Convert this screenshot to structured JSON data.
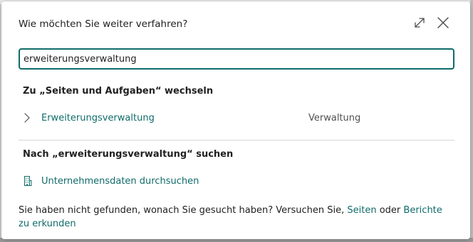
{
  "dialog": {
    "title": "Wie möchten Sie weiter verfahren?"
  },
  "search": {
    "value": "erweiterungsverwaltung"
  },
  "pages_section": {
    "heading": "Zu „Seiten und Aufgaben“ wechseln",
    "results": [
      {
        "label": "Erweiterungsverwaltung",
        "category": "Verwaltung"
      }
    ]
  },
  "search_section": {
    "heading": "Nach „erweiterungsverwaltung“ suchen",
    "company_data_link": "Unternehmensdaten durchsuchen"
  },
  "footer": {
    "text_before": "Sie haben nicht gefunden, wonach Sie gesucht haben? Versuchen Sie, ",
    "link_pages": "Seiten",
    "text_middle": " oder ",
    "link_reports": "Berichte zu erkunden"
  },
  "colors": {
    "accent": "#0f6c69",
    "text": "#212121",
    "muted": "#505050"
  },
  "icons": {
    "expand": "expand-icon",
    "close": "close-icon",
    "chevron": "chevron-right-icon",
    "building": "building-icon"
  }
}
